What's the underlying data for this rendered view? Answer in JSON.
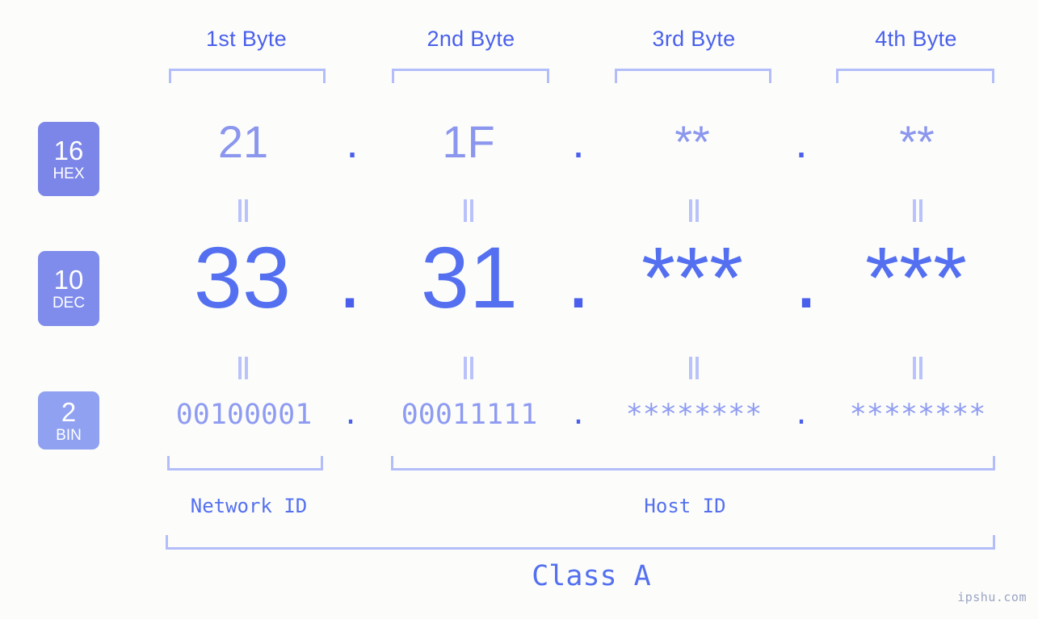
{
  "meta": {
    "background": "#fcfdfa",
    "accent": "#5470f0",
    "accent_light": "#b3bdfa",
    "watermark": "ipshu.com"
  },
  "byte_headers": [
    {
      "label": "1st Byte"
    },
    {
      "label": "2nd Byte"
    },
    {
      "label": "3rd Byte"
    },
    {
      "label": "4th Byte"
    }
  ],
  "rows": {
    "hex": {
      "badge_num": "16",
      "badge_sub": "HEX",
      "badge_color": "#7b86e8",
      "values": [
        "21",
        "1F",
        "**",
        "**"
      ],
      "separator": "."
    },
    "dec": {
      "badge_num": "10",
      "badge_sub": "DEC",
      "badge_color": "#7f8cec",
      "values": [
        "33",
        "31",
        "***",
        "***"
      ],
      "separator": "."
    },
    "bin": {
      "badge_num": "2",
      "badge_sub": "BIN",
      "badge_color": "#8fa1f0",
      "values": [
        "00100001",
        "00011111",
        "********",
        "********"
      ],
      "separator": "."
    }
  },
  "connectors": {
    "glyph": "equals-rotated"
  },
  "segments": {
    "network_id": "Network ID",
    "host_id": "Host ID"
  },
  "class": {
    "label": "Class A"
  }
}
